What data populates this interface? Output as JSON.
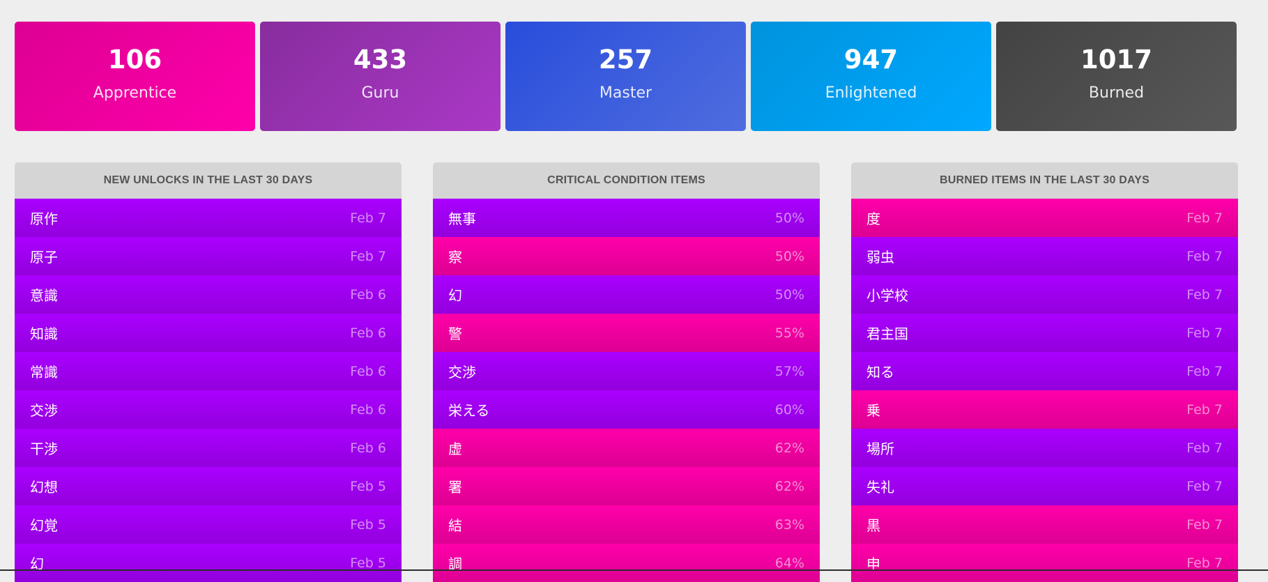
{
  "srs": [
    {
      "count": "106",
      "label": "Apprentice"
    },
    {
      "count": "433",
      "label": "Guru"
    },
    {
      "count": "257",
      "label": "Master"
    },
    {
      "count": "947",
      "label": "Enlightened"
    },
    {
      "count": "1017",
      "label": "Burned"
    }
  ],
  "colors": {
    "apprentice": "#dd0093",
    "guru": "#882d9e",
    "master": "#294ddb",
    "enlightened": "#0093dd",
    "burned": "#434343",
    "kanji_row": "#aa00ff",
    "radical_row": "#ff00aa",
    "panel_header": "#d5d5d5"
  },
  "new_unlocks": {
    "title": "NEW UNLOCKS IN THE LAST 30 DAYS",
    "items": [
      {
        "text": "原作",
        "meta": "Feb 7",
        "type": "kanji"
      },
      {
        "text": "原子",
        "meta": "Feb 7",
        "type": "kanji"
      },
      {
        "text": "意識",
        "meta": "Feb 6",
        "type": "kanji"
      },
      {
        "text": "知識",
        "meta": "Feb 6",
        "type": "kanji"
      },
      {
        "text": "常識",
        "meta": "Feb 6",
        "type": "kanji"
      },
      {
        "text": "交渉",
        "meta": "Feb 6",
        "type": "kanji"
      },
      {
        "text": "干渉",
        "meta": "Feb 6",
        "type": "kanji"
      },
      {
        "text": "幻想",
        "meta": "Feb 5",
        "type": "kanji"
      },
      {
        "text": "幻覚",
        "meta": "Feb 5",
        "type": "kanji"
      },
      {
        "text": "幻",
        "meta": "Feb 5",
        "type": "kanji"
      }
    ]
  },
  "critical_items": {
    "title": "CRITICAL CONDITION ITEMS",
    "items": [
      {
        "text": "無事",
        "meta": "50%",
        "type": "kanji"
      },
      {
        "text": "察",
        "meta": "50%",
        "type": "radical"
      },
      {
        "text": "幻",
        "meta": "50%",
        "type": "kanji"
      },
      {
        "text": "警",
        "meta": "55%",
        "type": "radical"
      },
      {
        "text": "交渉",
        "meta": "57%",
        "type": "kanji"
      },
      {
        "text": "栄える",
        "meta": "60%",
        "type": "kanji"
      },
      {
        "text": "虚",
        "meta": "62%",
        "type": "radical"
      },
      {
        "text": "署",
        "meta": "62%",
        "type": "radical"
      },
      {
        "text": "結",
        "meta": "63%",
        "type": "radical"
      },
      {
        "text": "調",
        "meta": "64%",
        "type": "radical"
      }
    ]
  },
  "burned_items": {
    "title": "BURNED ITEMS IN THE LAST 30 DAYS",
    "items": [
      {
        "text": "度",
        "meta": "Feb 7",
        "type": "radical"
      },
      {
        "text": "弱虫",
        "meta": "Feb 7",
        "type": "kanji"
      },
      {
        "text": "小学校",
        "meta": "Feb 7",
        "type": "kanji"
      },
      {
        "text": "君主国",
        "meta": "Feb 7",
        "type": "kanji"
      },
      {
        "text": "知る",
        "meta": "Feb 7",
        "type": "kanji"
      },
      {
        "text": "乗",
        "meta": "Feb 7",
        "type": "radical"
      },
      {
        "text": "場所",
        "meta": "Feb 7",
        "type": "kanji"
      },
      {
        "text": "失礼",
        "meta": "Feb 7",
        "type": "kanji"
      },
      {
        "text": "黒",
        "meta": "Feb 7",
        "type": "radical"
      },
      {
        "text": "申",
        "meta": "Feb 7",
        "type": "radical"
      }
    ]
  }
}
